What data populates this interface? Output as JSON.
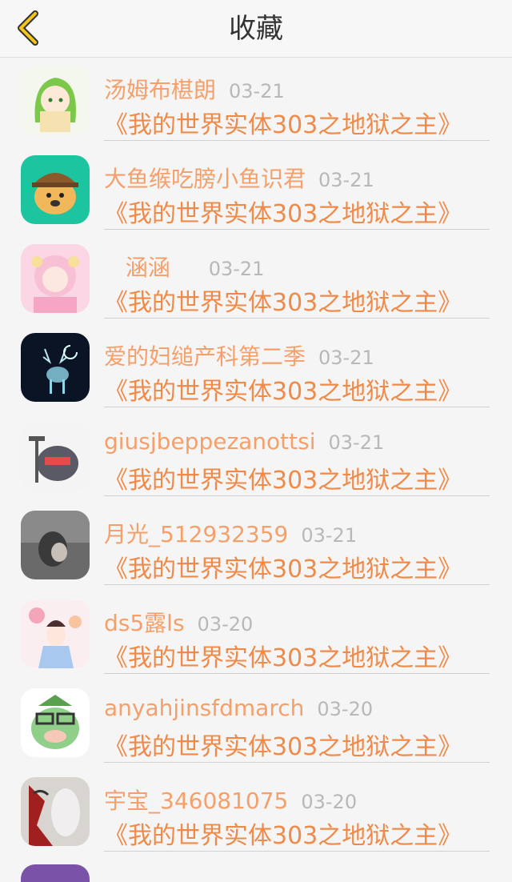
{
  "header": {
    "title": "收藏",
    "back_icon": "chevron-left-icon",
    "accent": "#f5c518"
  },
  "favorites": [
    {
      "user": "汤姆布椹朗",
      "date": "03-21",
      "book": "《我的世界实体303之地狱之主》"
    },
    {
      "user": "大鱼缑吃膀小鱼识君",
      "date": "03-21",
      "book": "《我的世界实体303之地狱之主》"
    },
    {
      "user": "   涵涵",
      "date": "03-21",
      "book": "《我的世界实体303之地狱之主》"
    },
    {
      "user": "爱的妇缒产科第二季",
      "date": "03-21",
      "book": "《我的世界实体303之地狱之主》"
    },
    {
      "user": "giusjbeppezanottsi",
      "date": "03-21",
      "book": "《我的世界实体303之地狱之主》"
    },
    {
      "user": "月光_512932359",
      "date": "03-21",
      "book": "《我的世界实体303之地狱之主》"
    },
    {
      "user": "ds5露ls",
      "date": "03-20",
      "book": "《我的世界实体303之地狱之主》"
    },
    {
      "user": "anyahjinsfdmarch",
      "date": "03-20",
      "book": "《我的世界实体303之地狱之主》"
    },
    {
      "user": "宇宝_346081075",
      "date": "03-20",
      "book": "《我的世界实体303之地狱之主》"
    }
  ],
  "colors": {
    "name": "#f5a06a",
    "book": "#f08a48",
    "date": "#b8b8b8"
  }
}
